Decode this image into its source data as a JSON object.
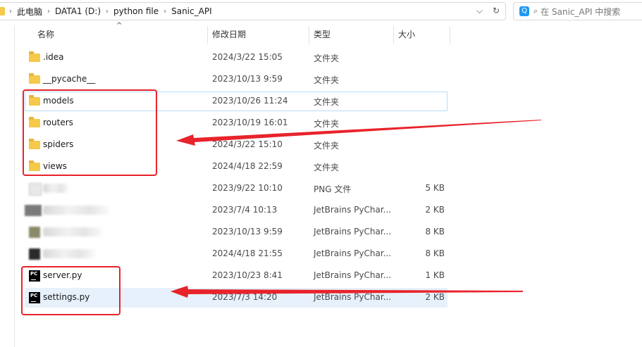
{
  "address_bar": {
    "breadcrumbs": [
      "此电脑",
      "DATA1 (D:)",
      "python file",
      "Sanic_API"
    ],
    "separator": "›",
    "dropdown_glyph": "⌵",
    "refresh_glyph": "↻"
  },
  "search": {
    "logo_glyph": "Q",
    "icon_glyph": "⌕",
    "placeholder": "在 Sanic_API 中搜索"
  },
  "columns": {
    "name": "名称",
    "date": "修改日期",
    "type": "类型",
    "size": "大小"
  },
  "sort_indicator": "^",
  "files": [
    {
      "name": ".idea",
      "date": "2024/3/22 15:05",
      "type": "文件夹",
      "size": "",
      "icon": "folder-icon"
    },
    {
      "name": "__pycache__",
      "date": "2023/10/13 9:59",
      "type": "文件夹",
      "size": "",
      "icon": "folder-icon"
    },
    {
      "name": "models",
      "date": "2023/10/26 11:24",
      "type": "文件夹",
      "size": "",
      "icon": "folder-icon"
    },
    {
      "name": "routers",
      "date": "2023/10/19 16:01",
      "type": "文件夹",
      "size": "",
      "icon": "folder-icon"
    },
    {
      "name": "spiders",
      "date": "2024/3/22 15:10",
      "type": "文件夹",
      "size": "",
      "icon": "folder-icon"
    },
    {
      "name": "views",
      "date": "2024/4/18 22:59",
      "type": "文件夹",
      "size": "",
      "icon": "folder-icon"
    },
    {
      "name": "",
      "date": "2023/9/22 10:10",
      "type": "PNG 文件",
      "size": "5 KB",
      "icon": "png-file-icon"
    },
    {
      "name": "",
      "date": "2023/7/4 10:13",
      "type": "JetBrains PyChar...",
      "size": "2 KB",
      "icon": "pycharm-file-icon"
    },
    {
      "name": "",
      "date": "2023/10/13 9:59",
      "type": "JetBrains PyChar...",
      "size": "8 KB",
      "icon": "pycharm-file-icon"
    },
    {
      "name": "",
      "date": "2024/4/18 21:55",
      "type": "JetBrains PyChar...",
      "size": "8 KB",
      "icon": "pycharm-file-icon"
    },
    {
      "name": "server.py",
      "date": "2023/10/23 8:41",
      "type": "JetBrains PyChar...",
      "size": "1 KB",
      "icon": "pycharm-file-icon"
    },
    {
      "name": "settings.py",
      "date": "2023/7/3 14:20",
      "type": "JetBrains PyChar...",
      "size": "2 KB",
      "icon": "pycharm-file-icon"
    }
  ],
  "pc_icon_text": "PC",
  "colors": {
    "annotation_red": "#e8232b",
    "selected_row": "#e6f1fb",
    "folder": "#f6c94b"
  }
}
